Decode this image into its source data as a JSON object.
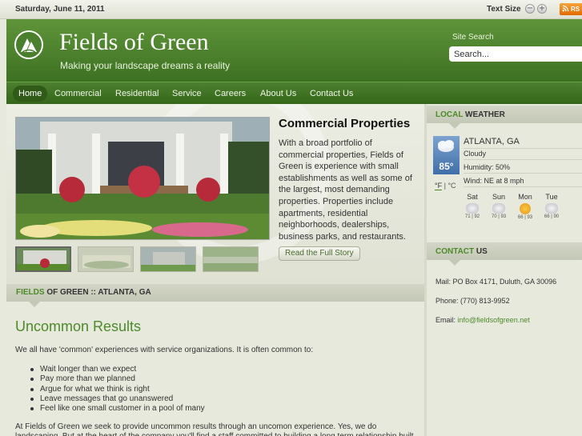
{
  "topbar": {
    "date": "Saturday, June 11, 2011",
    "text_size_label": "Text Size",
    "decrease": "−",
    "increase": "+",
    "rss": "RS"
  },
  "header": {
    "title": "Fields of Green",
    "tagline": "Making your landscape dreams a reality",
    "search_label": "Site Search",
    "search_placeholder": "Search..."
  },
  "nav": {
    "items": [
      "Home",
      "Commercial",
      "Residential",
      "Service",
      "Careers",
      "About Us",
      "Contact Us"
    ]
  },
  "feature": {
    "title": "Commercial Properties",
    "text": "With a broad portfolio of commercial properties, Fields of Green is experience with small establishments as well as some of the largest, most demanding properties. Properties include apartments, residential neighborhoods, dealerships, business parks, and restaurants.",
    "button": "Read the Full Story"
  },
  "section": {
    "label_green": "FIELDS",
    "label_rest": " OF GREEN :: ATLANTA, GA"
  },
  "content": {
    "title": "Uncommon Results",
    "intro": "We all have 'common' experiences with service organizations. It is often common to:",
    "bullets": [
      "Wait longer than we expect",
      "Pay more than we planned",
      "Argue for what we think is right",
      "Leave messages that go unanswered",
      "Feel like one small customer in a pool of many"
    ],
    "paragraph": "At Fields of Green we seek to provide uncommon results through an uncomon experience. Yes, we do landscaping. But at the heart of the company you'll find a staff committed to building a long term relationship built on trust and uncommon"
  },
  "weather": {
    "head_green": "LOCAL",
    "head_rest": " WEATHER",
    "city": "ATLANTA, GA",
    "condition": "Cloudy",
    "humidity": "Humidity: 50%",
    "wind": "Wind: NE at 8 mph",
    "temp": "85°",
    "unit_f": "°F",
    "unit_sep": " | ",
    "unit_c": "°C",
    "forecast": [
      {
        "day": "Sat",
        "hl": "71 | 92",
        "icon": "cloud"
      },
      {
        "day": "Sun",
        "hl": "70 | 93",
        "icon": "cloud"
      },
      {
        "day": "Mon",
        "hl": "66 | 93",
        "icon": "sun"
      },
      {
        "day": "Tue",
        "hl": "66 | 90",
        "icon": "cloud"
      }
    ]
  },
  "contact": {
    "head_green": "CONTACT",
    "head_rest": " US",
    "mail": "Mail: PO Box 4171, Duluth, GA 30096",
    "phone": "Phone: (770) 813-9952",
    "email_label": "Email: ",
    "email": "info@fieldsofgreen.net"
  }
}
